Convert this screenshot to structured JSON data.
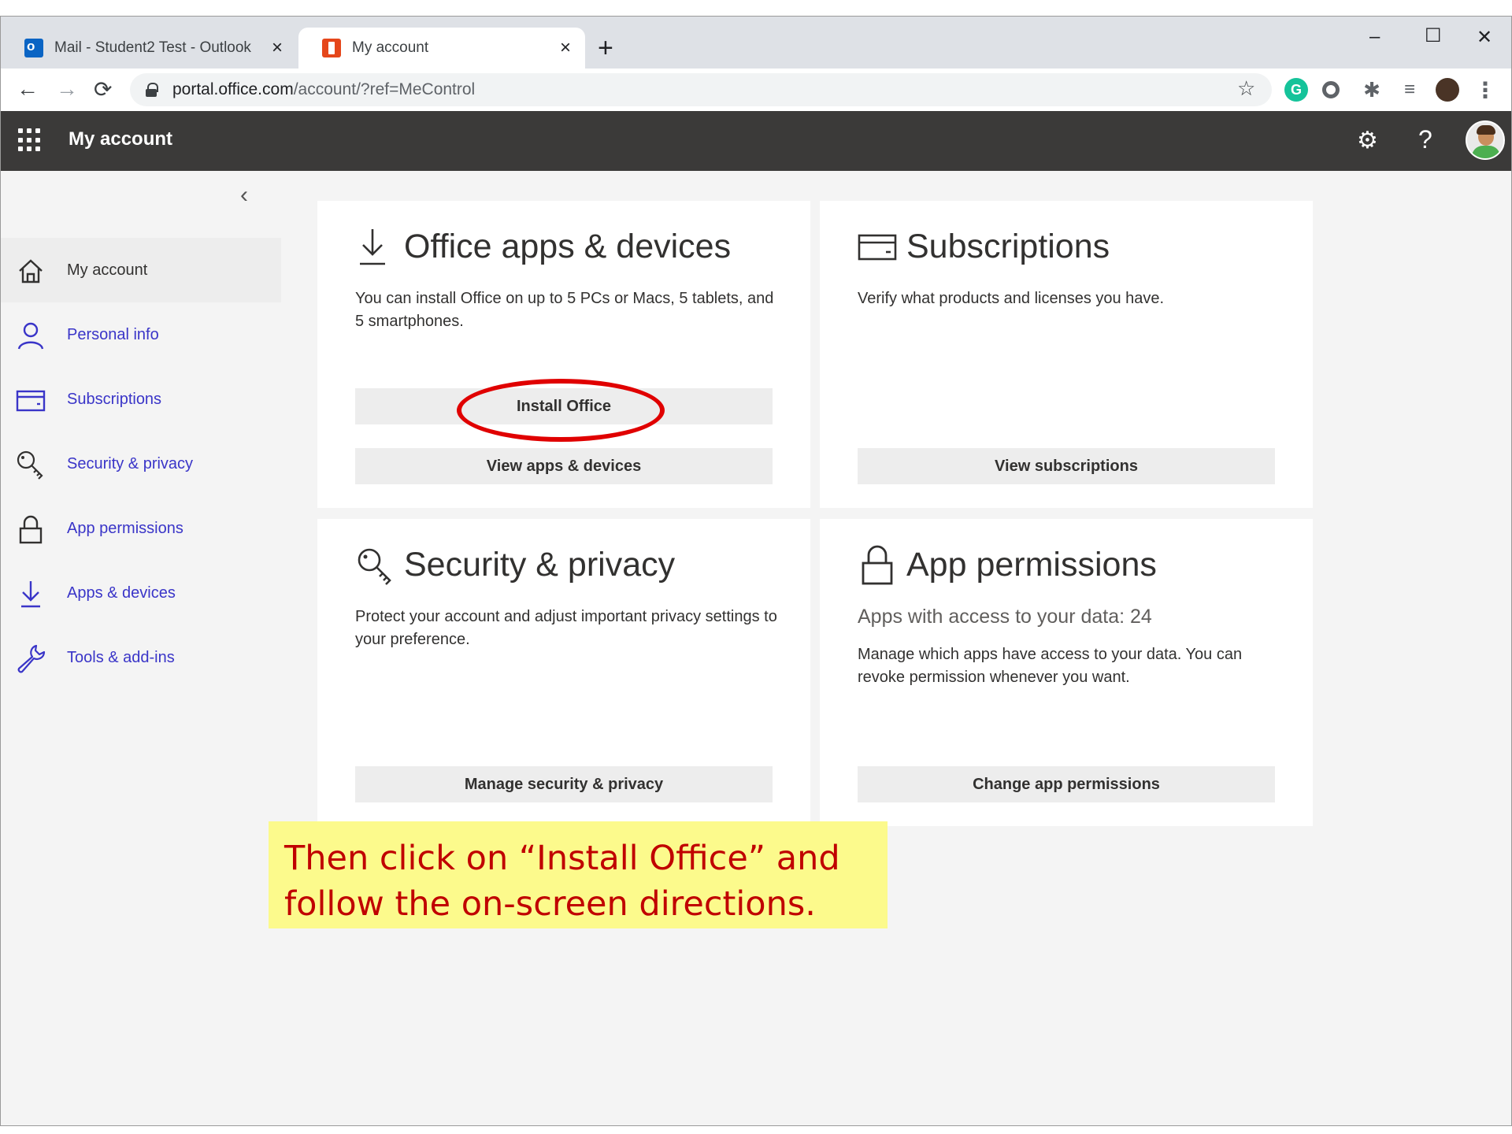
{
  "browser": {
    "tabs": [
      {
        "title": "Mail - Student2 Test - Outlook",
        "icon": "outlook-icon"
      },
      {
        "title": "My account",
        "icon": "office-icon"
      }
    ],
    "url_host": "portal.office.com",
    "url_path": "/account/?ref=MeControl"
  },
  "app": {
    "title": "My account"
  },
  "sidebar": {
    "items": [
      {
        "label": "My account",
        "icon": "home-icon"
      },
      {
        "label": "Personal info",
        "icon": "person-icon"
      },
      {
        "label": "Subscriptions",
        "icon": "card-icon"
      },
      {
        "label": "Security & privacy",
        "icon": "key-icon"
      },
      {
        "label": "App permissions",
        "icon": "lock-icon"
      },
      {
        "label": "Apps & devices",
        "icon": "download-icon"
      },
      {
        "label": "Tools & add-ins",
        "icon": "wrench-icon"
      }
    ]
  },
  "cards": {
    "office": {
      "title": "Office apps & devices",
      "desc": "You can install Office on up to 5 PCs or Macs, 5 tablets, and 5 smartphones.",
      "install_button": "Install Office",
      "view_button": "View apps & devices"
    },
    "subscriptions": {
      "title": "Subscriptions",
      "desc": "Verify what products and licenses you have.",
      "button": "View subscriptions"
    },
    "security": {
      "title": "Security & privacy",
      "desc": "Protect your account and adjust important privacy settings to your preference.",
      "button": "Manage security & privacy"
    },
    "permissions": {
      "title": "App permissions",
      "count_text": "Apps with access to your data: 24",
      "desc": "Manage which apps have access to your data. You can revoke permission whenever you want.",
      "button": "Change app permissions"
    }
  },
  "callout": {
    "text": "Then click on “Install Office” and follow the on-screen directions."
  },
  "colors": {
    "accent": "#3a35c8",
    "header": "#3b3a39",
    "callout_bg": "#fcfa8c",
    "callout_text": "#c00000",
    "ring": "#e00000"
  }
}
